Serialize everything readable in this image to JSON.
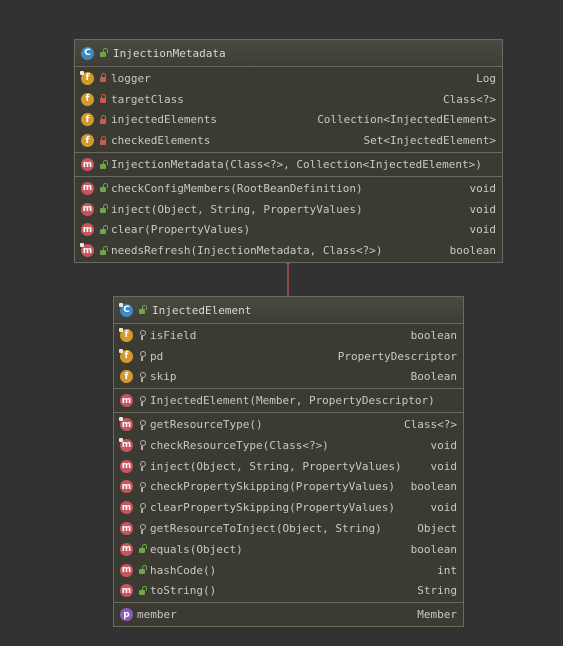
{
  "outer_class": {
    "name": "InjectionMetadata",
    "icon": "class-icon",
    "fields": [
      {
        "badge": "f",
        "static": true,
        "visibility": "private",
        "name": "logger",
        "type": "Log"
      },
      {
        "badge": "f",
        "static": false,
        "visibility": "private",
        "name": "targetClass",
        "type": "Class<?>"
      },
      {
        "badge": "f",
        "static": false,
        "visibility": "private",
        "name": "injectedElements",
        "type": "Collection<InjectedElement>"
      },
      {
        "badge": "f",
        "static": false,
        "visibility": "private",
        "name": "checkedElements",
        "type": "Set<InjectedElement>"
      }
    ],
    "constructors": [
      {
        "badge": "m",
        "static": false,
        "visibility": "public",
        "name": "InjectionMetadata(Class<?>, Collection<InjectedElement>)",
        "type": ""
      }
    ],
    "methods": [
      {
        "badge": "m",
        "static": false,
        "visibility": "public",
        "name": "checkConfigMembers(RootBeanDefinition)",
        "type": "void"
      },
      {
        "badge": "m",
        "static": false,
        "visibility": "public",
        "name": "inject(Object, String, PropertyValues)",
        "type": "void"
      },
      {
        "badge": "m",
        "static": false,
        "visibility": "public",
        "name": "clear(PropertyValues)",
        "type": "void"
      },
      {
        "badge": "m",
        "static": true,
        "visibility": "public",
        "name": "needsRefresh(InjectionMetadata, Class<?>)",
        "type": "boolean"
      }
    ]
  },
  "inner_class": {
    "name": "InjectedElement",
    "icon": "abstract-class-icon",
    "fields": [
      {
        "badge": "f",
        "static": true,
        "visibility": "package",
        "name": "isField",
        "type": "boolean"
      },
      {
        "badge": "f",
        "static": true,
        "visibility": "package",
        "name": "pd",
        "type": "PropertyDescriptor"
      },
      {
        "badge": "f",
        "static": false,
        "visibility": "package",
        "name": "skip",
        "type": "Boolean"
      }
    ],
    "constructors": [
      {
        "badge": "m",
        "static": false,
        "visibility": "package",
        "name": "InjectedElement(Member, PropertyDescriptor)",
        "type": ""
      }
    ],
    "methods": [
      {
        "badge": "m",
        "static": true,
        "visibility": "package",
        "name": "getResourceType()",
        "type": "Class<?>"
      },
      {
        "badge": "m",
        "static": true,
        "visibility": "package",
        "name": "checkResourceType(Class<?>)",
        "type": "void"
      },
      {
        "badge": "m",
        "static": false,
        "visibility": "package",
        "name": "inject(Object, String, PropertyValues)",
        "type": "void"
      },
      {
        "badge": "m",
        "static": false,
        "visibility": "package",
        "name": "checkPropertySkipping(PropertyValues)",
        "type": "boolean"
      },
      {
        "badge": "m",
        "static": false,
        "visibility": "package",
        "name": "clearPropertySkipping(PropertyValues)",
        "type": "void"
      },
      {
        "badge": "m",
        "static": false,
        "visibility": "package",
        "name": "getResourceToInject(Object, String)",
        "type": "Object"
      },
      {
        "badge": "m",
        "static": false,
        "visibility": "public",
        "name": "equals(Object)",
        "type": "boolean"
      },
      {
        "badge": "m",
        "static": false,
        "visibility": "public",
        "name": "hashCode()",
        "type": "int"
      },
      {
        "badge": "m",
        "static": false,
        "visibility": "public",
        "name": "toString()",
        "type": "String"
      }
    ],
    "properties": [
      {
        "badge": "p",
        "static": false,
        "visibility": "",
        "name": "member",
        "type": "Member"
      }
    ]
  },
  "colors": {
    "background": "#323232",
    "box": "#3b3b34",
    "border": "#6a6a60",
    "connector": "#c85a5a",
    "field_badge": "#d29a2d",
    "method_badge": "#c6555d",
    "class_badge": "#3c8ac1",
    "property_badge": "#8c5bb8"
  }
}
